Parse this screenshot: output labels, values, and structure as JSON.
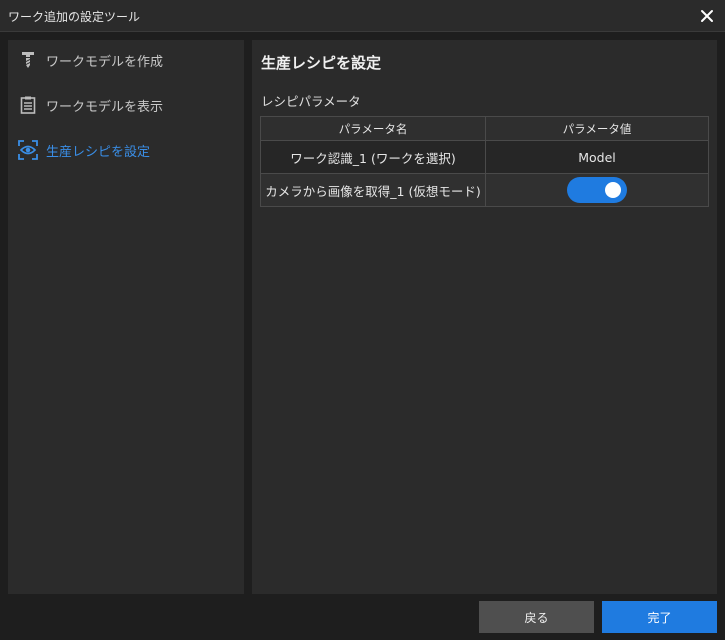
{
  "window": {
    "title": "ワーク追加の設定ツール"
  },
  "sidebar": {
    "items": [
      {
        "label": "ワークモデルを作成",
        "icon": "screw-icon",
        "active": false
      },
      {
        "label": "ワークモデルを表示",
        "icon": "list-icon",
        "active": false
      },
      {
        "label": "生産レシピを設定",
        "icon": "eye-scan-icon",
        "active": true
      }
    ]
  },
  "main": {
    "title": "生産レシピを設定",
    "section_label": "レシピパラメータ",
    "table": {
      "headers": [
        "パラメータ名",
        "パラメータ値"
      ],
      "rows": [
        {
          "name": "ワーク認識_1 (ワークを選択)",
          "value": "Model"
        },
        {
          "name": "カメラから画像を取得_1 (仮想モード)",
          "value": true
        }
      ]
    }
  },
  "footer": {
    "back_label": "戻る",
    "done_label": "完了"
  },
  "colors": {
    "accent": "#1f7be0",
    "active_text": "#3a8ee6",
    "background": "#1e1e1e",
    "panel": "#2b2b2b"
  }
}
